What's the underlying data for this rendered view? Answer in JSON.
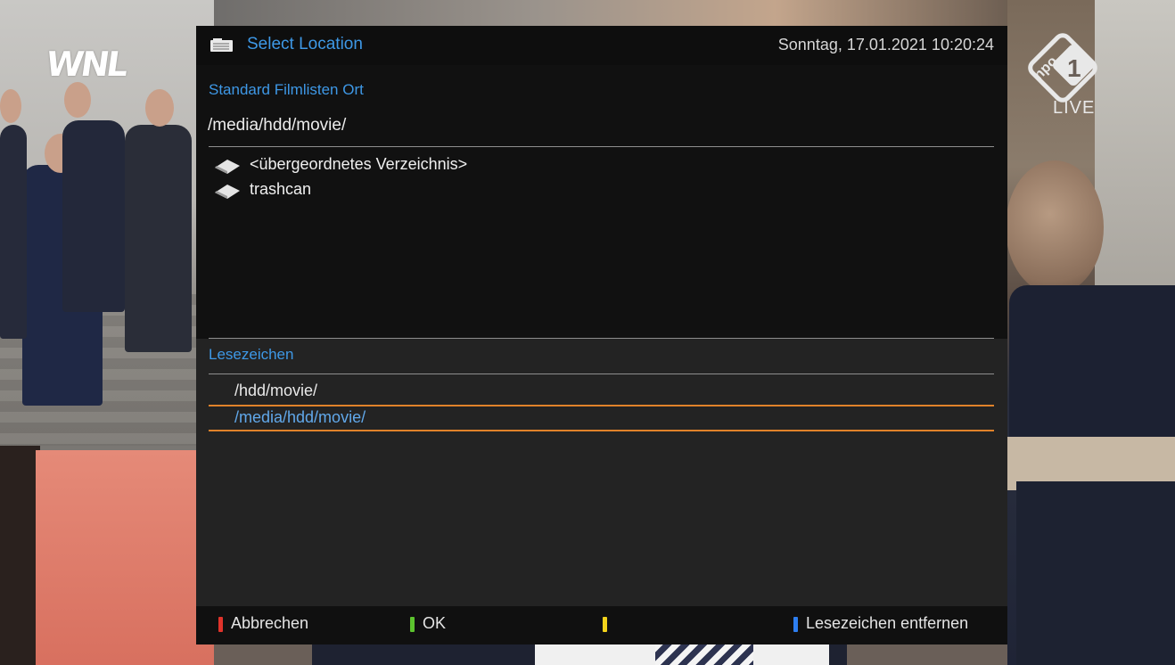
{
  "channel": {
    "left_logo": "WNL",
    "right_logo_brand": "npo",
    "right_logo_number": "1",
    "live_label": "LIVE"
  },
  "dialog": {
    "title": "Select Location",
    "datetime": "Sonntag, 17.01.2021  10:20:24",
    "location_label": "Standard Filmlisten Ort",
    "current_path": "/media/hdd/movie/",
    "entries": [
      {
        "name": "<übergeordnetes Verzeichnis>",
        "icon": "folder-icon"
      },
      {
        "name": "trashcan",
        "icon": "folder-icon"
      }
    ],
    "bookmarks_label": "Lesezeichen",
    "bookmarks": [
      {
        "path": "/hdd/movie/",
        "selected": false
      },
      {
        "path": "/media/hdd/movie/",
        "selected": true
      }
    ]
  },
  "footer": {
    "red_label": "Abbrechen",
    "green_label": "OK",
    "yellow_label": "",
    "blue_label": "Lesezeichen entfernen"
  },
  "colors": {
    "accent": "#3e98e6",
    "selection_line": "#e0822a",
    "red": "#e0332b",
    "green": "#5cc32e",
    "yellow": "#f3d31b",
    "blue": "#2d7ef0"
  }
}
